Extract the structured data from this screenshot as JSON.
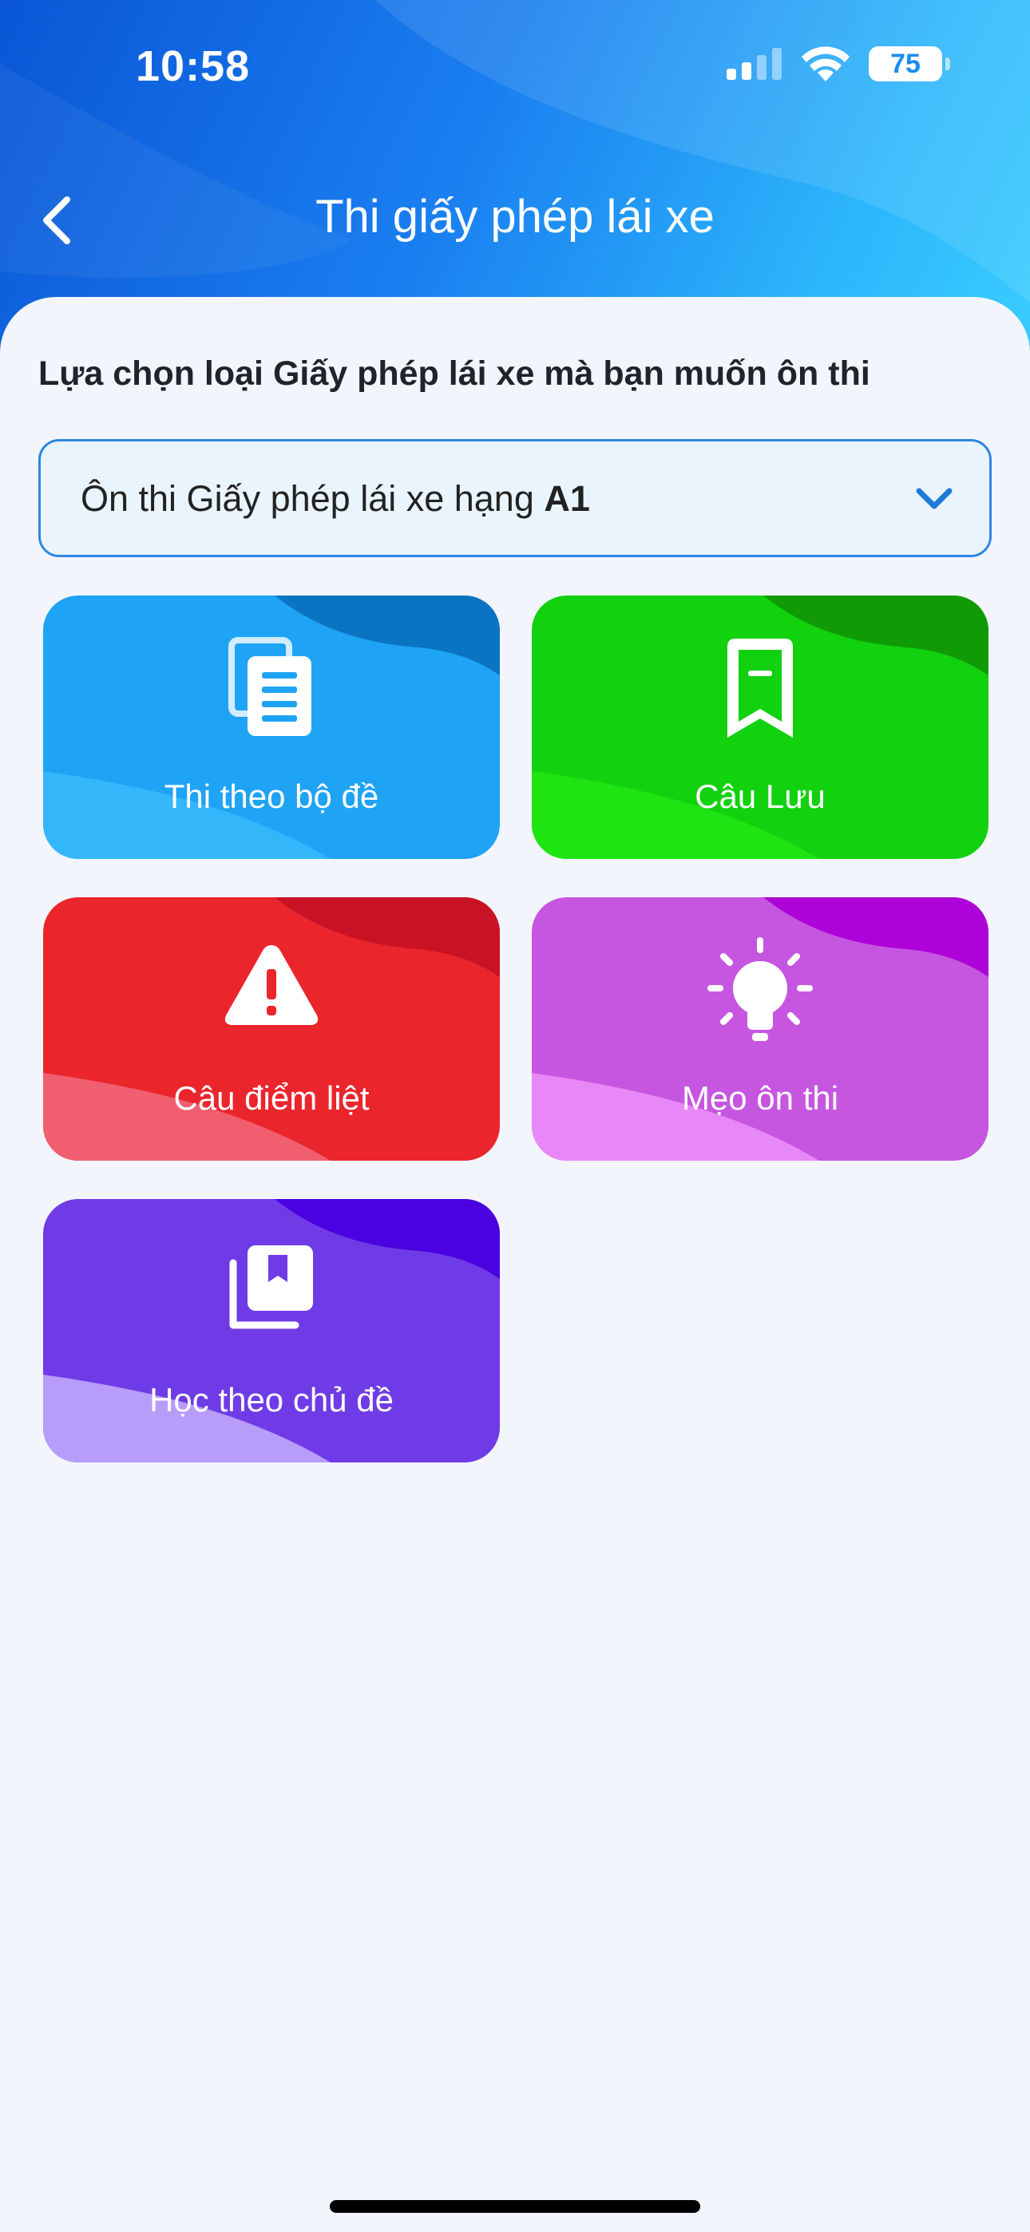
{
  "status_bar": {
    "time": "10:58",
    "battery": "75"
  },
  "header": {
    "title": "Thi giấy phép lái xe"
  },
  "prompt": "Lựa chọn loại Giấy phép lái xe mà bạn muốn ôn thi",
  "dropdown": {
    "label": "Ôn thi Giấy phép lái xe hạng ",
    "value": "A1"
  },
  "cards": [
    {
      "label": "Thi theo bộ đề",
      "icon": "documents-icon",
      "color": "#1fa3f4"
    },
    {
      "label": "Câu Lưu",
      "icon": "bookmark-icon",
      "color": "#12d10f"
    },
    {
      "label": "Câu điểm liệt",
      "icon": "warning-icon",
      "color": "#ea252c"
    },
    {
      "label": "Mẹo ôn thi",
      "icon": "lightbulb-icon",
      "color": "#c656e0"
    },
    {
      "label": "Học theo chủ đề",
      "icon": "book-stack-icon",
      "color": "#6f3be6"
    }
  ]
}
